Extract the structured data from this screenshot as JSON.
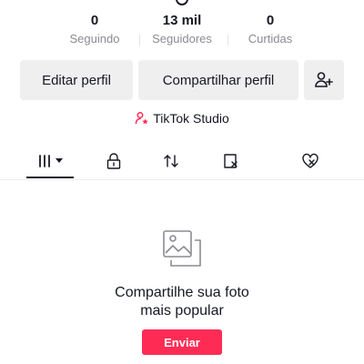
{
  "stats": [
    {
      "value": "0",
      "label": "Seguindo"
    },
    {
      "value": "13 mil",
      "label": "Seguidores"
    },
    {
      "value": "0",
      "label": "Curtidas"
    }
  ],
  "actions": {
    "edit_profile": "Editar perfil",
    "share_profile": "Compartilhar perfil",
    "add_friend_icon": "add-user-icon"
  },
  "studio": {
    "label": "TikTok Studio",
    "icon": "person-star-icon",
    "accent_color": "#fe2c55"
  },
  "tabs": [
    {
      "icon": "grid-icon",
      "dropdown": true,
      "selected": true
    },
    {
      "icon": "lock-icon"
    },
    {
      "icon": "repost-icon"
    },
    {
      "icon": "bookmark-icon"
    },
    {
      "icon": "liked-icon"
    }
  ],
  "empty_state": {
    "icon": "photos-icon",
    "title": "Compartilhe sua foto mais popular",
    "button_label": "Enviar",
    "button_color": "#fe2c55"
  }
}
